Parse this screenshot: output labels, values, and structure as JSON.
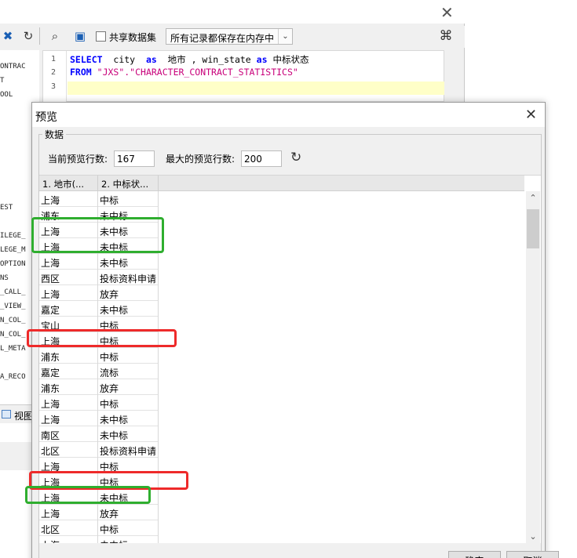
{
  "toolbar": {
    "share_dataset_label": "共享数据集",
    "memory_mode": "所有记录都保存在内存中"
  },
  "left_tree": [
    "ONTRAC",
    "T",
    "OOL",
    "EST",
    "ILEGE_",
    "LEGE_M",
    "OPTION",
    "NS",
    "_CALL_",
    "_VIEW_",
    "N_COL_",
    "N_COL_",
    "L_META",
    "A_RECO"
  ],
  "left_tab_label": "视图",
  "editor": {
    "line_numbers": [
      "1",
      "2",
      "3"
    ],
    "line1": {
      "kw1": "SELECT",
      "t1": "  city  ",
      "kw2": "as",
      "t2": "  地市 , win_state ",
      "kw3": "as",
      "t3": " 中标状态"
    },
    "line2": {
      "kw1": "FROM",
      "t1": " ",
      "s1": "\"JXS\".\"CHARACTER_CONTRACT_STATISTICS\""
    }
  },
  "dialog": {
    "title": "预览",
    "group_title": "数据",
    "current_rows_label": "当前预览行数:",
    "current_rows_value": "167",
    "max_rows_label": "最大的预览行数:",
    "max_rows_value": "200",
    "columns": [
      "1. 地市(...",
      "2. 中标状..."
    ],
    "rows": [
      [
        "上海",
        "中标"
      ],
      [
        "浦东",
        "未中标"
      ],
      [
        "上海",
        "未中标"
      ],
      [
        "上海",
        "未中标"
      ],
      [
        "上海",
        "未中标"
      ],
      [
        "西区",
        "投标资料申请"
      ],
      [
        "上海",
        "放弃"
      ],
      [
        "嘉定",
        "未中标"
      ],
      [
        "宝山",
        "中标"
      ],
      [
        "上海",
        "中标"
      ],
      [
        "浦东",
        "中标"
      ],
      [
        "嘉定",
        "流标"
      ],
      [
        "浦东",
        "放弃"
      ],
      [
        "上海",
        "中标"
      ],
      [
        "上海",
        "未中标"
      ],
      [
        "南区",
        "未中标"
      ],
      [
        "北区",
        "投标资料申请"
      ],
      [
        "上海",
        "中标"
      ],
      [
        "上海",
        "中标"
      ],
      [
        "上海",
        "未中标"
      ],
      [
        "上海",
        "放弃"
      ],
      [
        "北区",
        "中标"
      ],
      [
        "上海",
        "未中标"
      ]
    ],
    "ok_label": "确定",
    "cancel_label": "取消"
  },
  "colors": {
    "annotation_green": "#2fae2f",
    "annotation_red": "#ee2a2a",
    "sql_keyword": "#0000ff",
    "sql_string": "#c8007a"
  }
}
